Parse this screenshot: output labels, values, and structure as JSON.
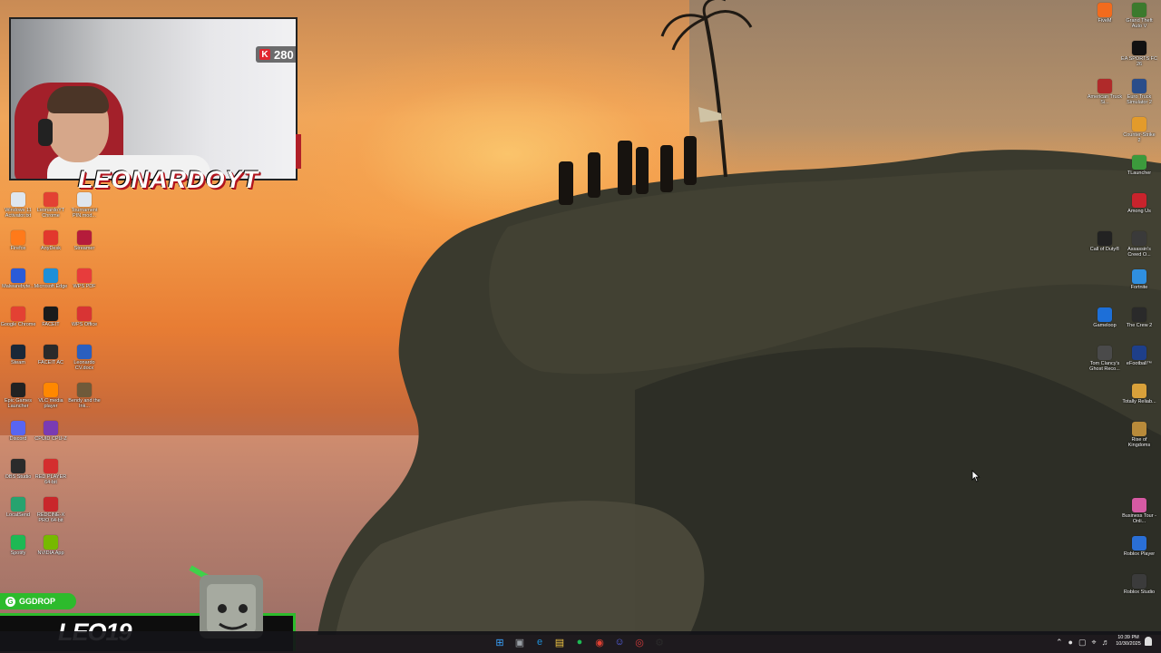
{
  "colors": {
    "accent_green": "#2dbb2c",
    "brand_red": "#b1141d",
    "taskbar": "#141418"
  },
  "webcam": {
    "sub_count": "280",
    "channel_logo": "LEONARDOYT"
  },
  "overlay": {
    "drop_label": "GGDROP",
    "streamer_name": "LEO19"
  },
  "left_icons": [
    {
      "label": "Windows 11 Activator.txt",
      "icon": "text-file-icon",
      "color": "#dfe6ee"
    },
    {
      "label": "LeonardoYT Chrome",
      "icon": "chrome-icon",
      "color": "#e34133"
    },
    {
      "label": "Tournament PIN.mod...",
      "icon": "text-file-icon",
      "color": "#dfe6ee"
    },
    {
      "label": "Firefox",
      "icon": "firefox-icon",
      "color": "#ff7a1a"
    },
    {
      "label": "AnyDesk",
      "icon": "anydesk-icon",
      "color": "#e2382d"
    },
    {
      "label": "Streamer",
      "icon": "streamer-app-icon",
      "color": "#b51c3b"
    },
    {
      "label": "Malwarebyte...",
      "icon": "malwarebytes-icon",
      "color": "#2a5bd7"
    },
    {
      "label": "Microsoft Edge",
      "icon": "edge-icon",
      "color": "#1e8fd8"
    },
    {
      "label": "WPS PDF",
      "icon": "wps-pdf-icon",
      "color": "#e73c3c"
    },
    {
      "label": "Google Chrome",
      "icon": "chrome-icon",
      "color": "#e34133"
    },
    {
      "label": "FACEIT",
      "icon": "faceit-icon",
      "color": "#1b1b1b"
    },
    {
      "label": "WPS Office",
      "icon": "wps-office-icon",
      "color": "#d83434"
    },
    {
      "label": "Steam",
      "icon": "steam-icon",
      "color": "#1b2838"
    },
    {
      "label": "FACEIT AC",
      "icon": "faceit-ac-icon",
      "color": "#2a2a2a"
    },
    {
      "label": "Leonardo CV.docx",
      "icon": "word-icon",
      "color": "#2b5fbf"
    },
    {
      "label": "Epic Games Launcher",
      "icon": "epic-games-icon",
      "color": "#222222"
    },
    {
      "label": "VLC media player",
      "icon": "vlc-icon",
      "color": "#ff8800"
    },
    {
      "label": "Bendy and the Ink...",
      "icon": "bendy-icon",
      "color": "#6f5a3a"
    },
    {
      "label": "Discord",
      "icon": "discord-icon",
      "color": "#5865f2"
    },
    {
      "label": "CPUID CPU-Z",
      "icon": "cpuz-icon",
      "color": "#7a3bb3"
    },
    {
      "label": "OBS Studio",
      "icon": "obs-icon",
      "color": "#2b2b2b"
    },
    {
      "label": "RED PLAYER 64-bit",
      "icon": "red-player-icon",
      "color": "#d42e2e"
    },
    {
      "label": "LocalSend",
      "icon": "localsend-icon",
      "color": "#27a36f"
    },
    {
      "label": "REDCINE-X PRO 64-bit",
      "icon": "redcine-icon",
      "color": "#c9272b"
    },
    {
      "label": "Spotify",
      "icon": "spotify-icon",
      "color": "#1db954"
    },
    {
      "label": "NVIDIA App",
      "icon": "nvidia-icon",
      "color": "#76b900"
    }
  ],
  "right_icons": [
    {
      "label": "FiveM",
      "icon": "fivem-icon",
      "color": "#f26b1d"
    },
    {
      "label": "Grand Theft Auto V",
      "icon": "gta-icon",
      "color": "#3c7a2d"
    },
    {
      "label": "EA SPORTS FC 26",
      "icon": "ea-fc-icon",
      "color": "#111111"
    },
    {
      "label": "American Truck Si...",
      "icon": "ats-icon",
      "color": "#b02a2a"
    },
    {
      "label": "Euro Truck Simulator 2",
      "icon": "ets2-icon",
      "color": "#2a4d8a"
    },
    {
      "label": "Counter-Strike 2",
      "icon": "cs2-icon",
      "color": "#e39b2b"
    },
    {
      "label": "TLauncher",
      "icon": "tlauncher-icon",
      "color": "#3c9a3c"
    },
    {
      "label": "Among Us",
      "icon": "among-us-icon",
      "color": "#c8232c"
    },
    {
      "label": "Call of Duty®",
      "icon": "cod-icon",
      "color": "#222222"
    },
    {
      "label": "Assassin's Creed O...",
      "icon": "assassins-creed-icon",
      "color": "#3a3a3a"
    },
    {
      "label": "Fortnite",
      "icon": "fortnite-icon",
      "color": "#2f8fe0"
    },
    {
      "label": "Gameloop",
      "icon": "gameloop-icon",
      "color": "#1d6fd8"
    },
    {
      "label": "The Crew 2",
      "icon": "the-crew-icon",
      "color": "#2a2a2a"
    },
    {
      "label": "Tom Clancy's Ghost Reco...",
      "icon": "ghost-recon-icon",
      "color": "#4a4a4a"
    },
    {
      "label": "eFootball™",
      "icon": "efootball-icon",
      "color": "#1e3f8a"
    },
    {
      "label": "Totally Reliab...",
      "icon": "totally-reliable-icon",
      "color": "#d9a13a"
    },
    {
      "label": "Rise of Kingdoms",
      "icon": "rise-of-kingdoms-icon",
      "color": "#b88a3a"
    },
    {
      "label": "Business Tour - Onli...",
      "icon": "business-tour-icon",
      "color": "#d65aa3"
    },
    {
      "label": "Roblox Player",
      "icon": "roblox-icon",
      "color": "#2a6fd6"
    },
    {
      "label": "Roblox Studio",
      "icon": "roblox-studio-icon",
      "color": "#3b3b3b"
    }
  ],
  "taskbar": {
    "apps": [
      {
        "icon": "windows-start-icon",
        "color": "#3aa3ff"
      },
      {
        "icon": "task-view-icon",
        "color": "#9aa0a6"
      },
      {
        "icon": "edge-icon",
        "color": "#1e8fd8"
      },
      {
        "icon": "file-explorer-icon",
        "color": "#f2c744"
      },
      {
        "icon": "spotify-icon",
        "color": "#1db954"
      },
      {
        "icon": "chrome-icon",
        "color": "#e34133"
      },
      {
        "icon": "discord-icon",
        "color": "#5865f2"
      },
      {
        "icon": "obs-icon",
        "color": "#d23b3b"
      },
      {
        "icon": "steam-icon",
        "color": "#2a2a2a"
      }
    ],
    "time": "10:39 PM",
    "date": "10/30/2025"
  }
}
